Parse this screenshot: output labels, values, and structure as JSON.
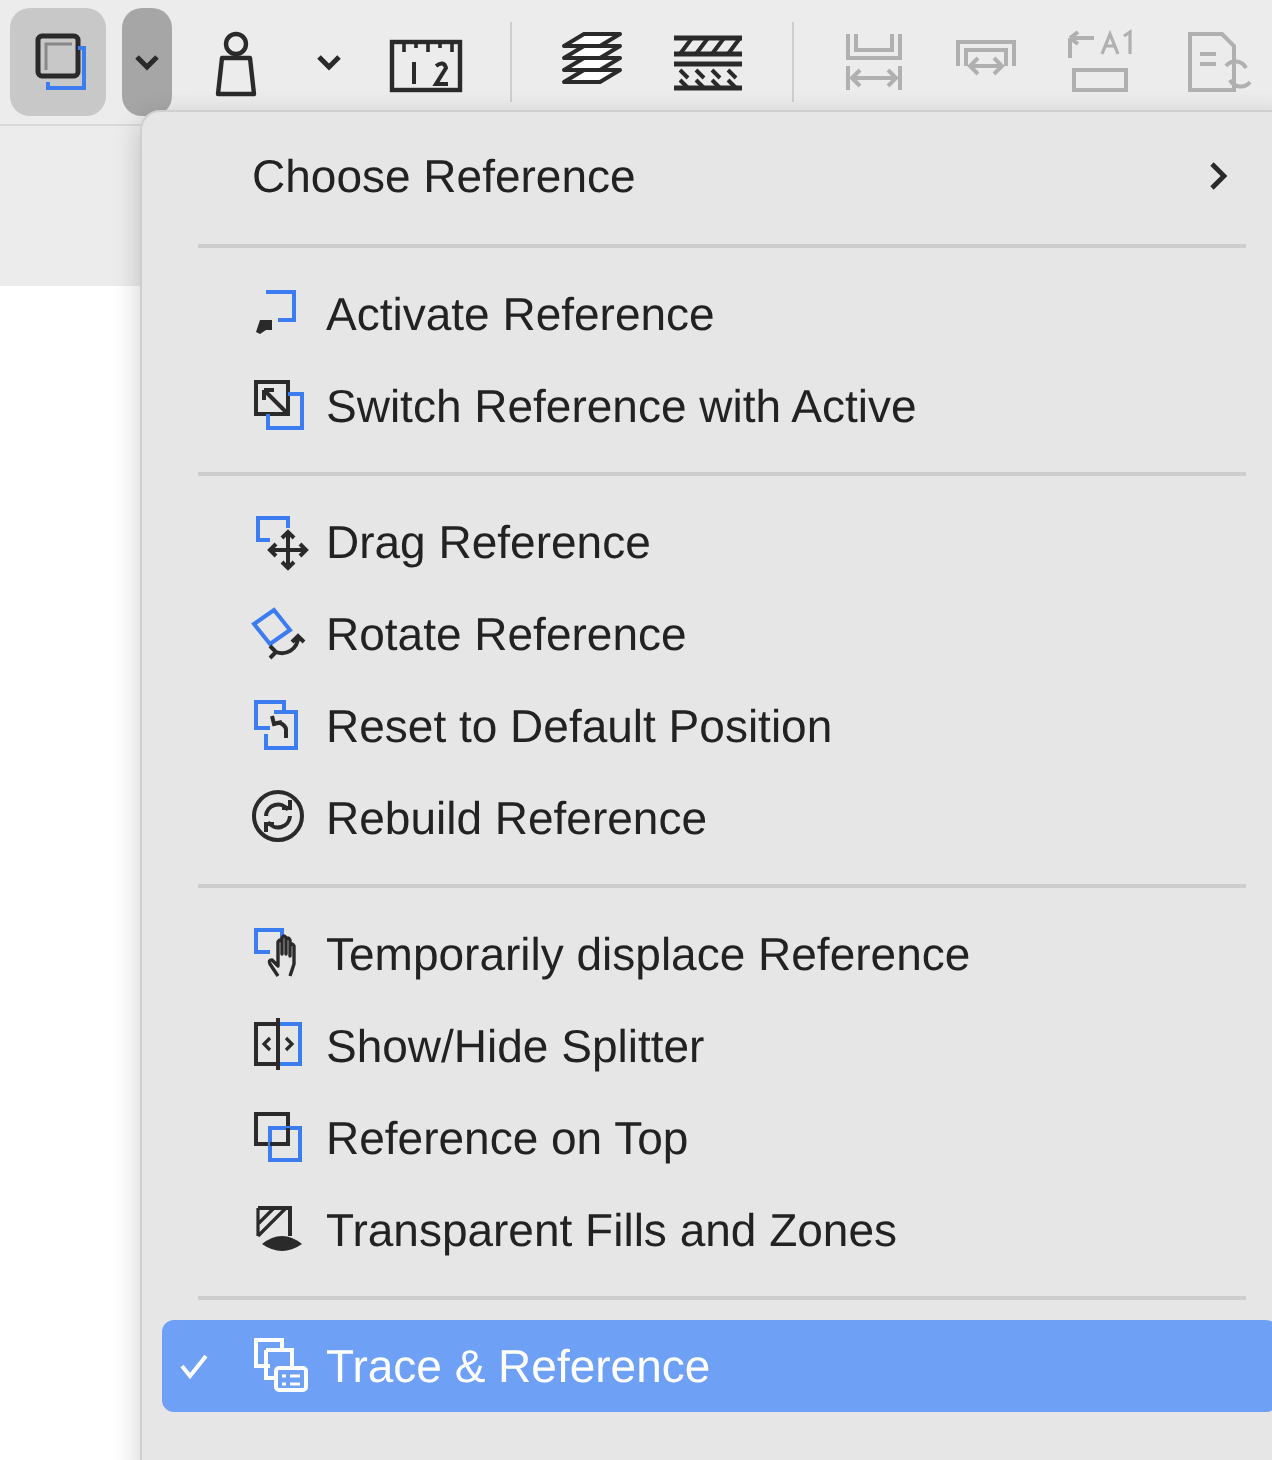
{
  "toolbar": {
    "items": [
      {
        "kind": "button",
        "pressed": true,
        "disabled": false
      },
      {
        "kind": "dropdown",
        "pressed": true,
        "disabled": false
      },
      {
        "kind": "button",
        "pressed": false,
        "disabled": false
      },
      {
        "kind": "dropdown",
        "pressed": false,
        "disabled": false
      },
      {
        "kind": "button",
        "pressed": false,
        "disabled": false
      },
      {
        "kind": "separator"
      },
      {
        "kind": "button",
        "pressed": false,
        "disabled": false
      },
      {
        "kind": "button",
        "pressed": false,
        "disabled": false
      },
      {
        "kind": "separator"
      },
      {
        "kind": "button",
        "pressed": false,
        "disabled": true
      },
      {
        "kind": "button",
        "pressed": false,
        "disabled": true
      },
      {
        "kind": "button",
        "pressed": false,
        "disabled": true
      },
      {
        "kind": "button",
        "pressed": false,
        "disabled": true
      }
    ]
  },
  "menu": {
    "sections": [
      [
        {
          "label": "Choose Reference",
          "kind": "submenu",
          "checked": false,
          "selected": false
        }
      ],
      [
        {
          "label": "Activate Reference",
          "kind": "command",
          "checked": false,
          "selected": false
        },
        {
          "label": "Switch Reference with Active",
          "kind": "command",
          "checked": false,
          "selected": false
        }
      ],
      [
        {
          "label": "Drag Reference",
          "kind": "command",
          "checked": false,
          "selected": false
        },
        {
          "label": "Rotate Reference",
          "kind": "command",
          "checked": false,
          "selected": false
        },
        {
          "label": "Reset to Default Position",
          "kind": "command",
          "checked": false,
          "selected": false
        },
        {
          "label": "Rebuild Reference",
          "kind": "command",
          "checked": false,
          "selected": false
        }
      ],
      [
        {
          "label": "Temporarily displace Reference",
          "kind": "command",
          "checked": false,
          "selected": false
        },
        {
          "label": "Show/Hide Splitter",
          "kind": "command",
          "checked": false,
          "selected": false
        },
        {
          "label": "Reference on Top",
          "kind": "command",
          "checked": false,
          "selected": false
        },
        {
          "label": "Transparent Fills and Zones",
          "kind": "command",
          "checked": false,
          "selected": false
        }
      ],
      [
        {
          "label": "Trace & Reference",
          "kind": "command",
          "checked": true,
          "selected": true
        }
      ]
    ]
  }
}
